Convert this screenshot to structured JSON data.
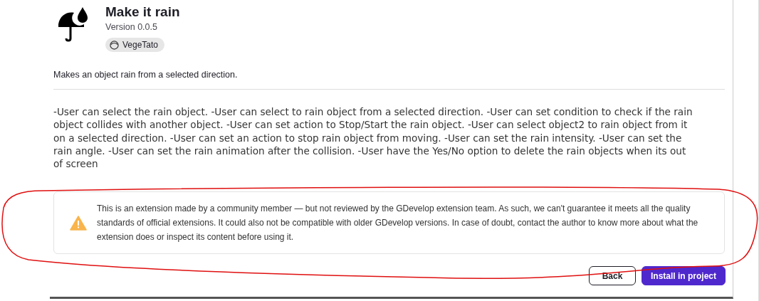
{
  "extension": {
    "title": "Make it rain",
    "version": "Version 0.0.5",
    "author": "VegeTato"
  },
  "short_description": "Makes an object rain from a selected direction.",
  "full_description": "-User can select the rain object. -User can select to rain object from a selected direction. -User can set condition to check if the rain object collides with another object. -User can set action to Stop/Start the rain object. -User can select object2 to rain object from it on a selected direction. -User can set an action to stop rain object from moving. -User can set the rain intensity. -User can set the rain angle. -User can set the rain animation after the collision. -User have the Yes/No option to delete the rain objects when its out of screen",
  "warning": "This is an extension made by a community member — but not reviewed by the GDevelop extension team. As such, we can't guarantee it meets all the quality standards of official extensions. It could also not be compatible with older GDevelop versions. In case of doubt, contact the author to know more about what the extension does or inspect its content before using it.",
  "buttons": [
    {
      "label": "Back",
      "kind": "secondary"
    },
    {
      "label": "Install in project",
      "kind": "primary"
    }
  ]
}
